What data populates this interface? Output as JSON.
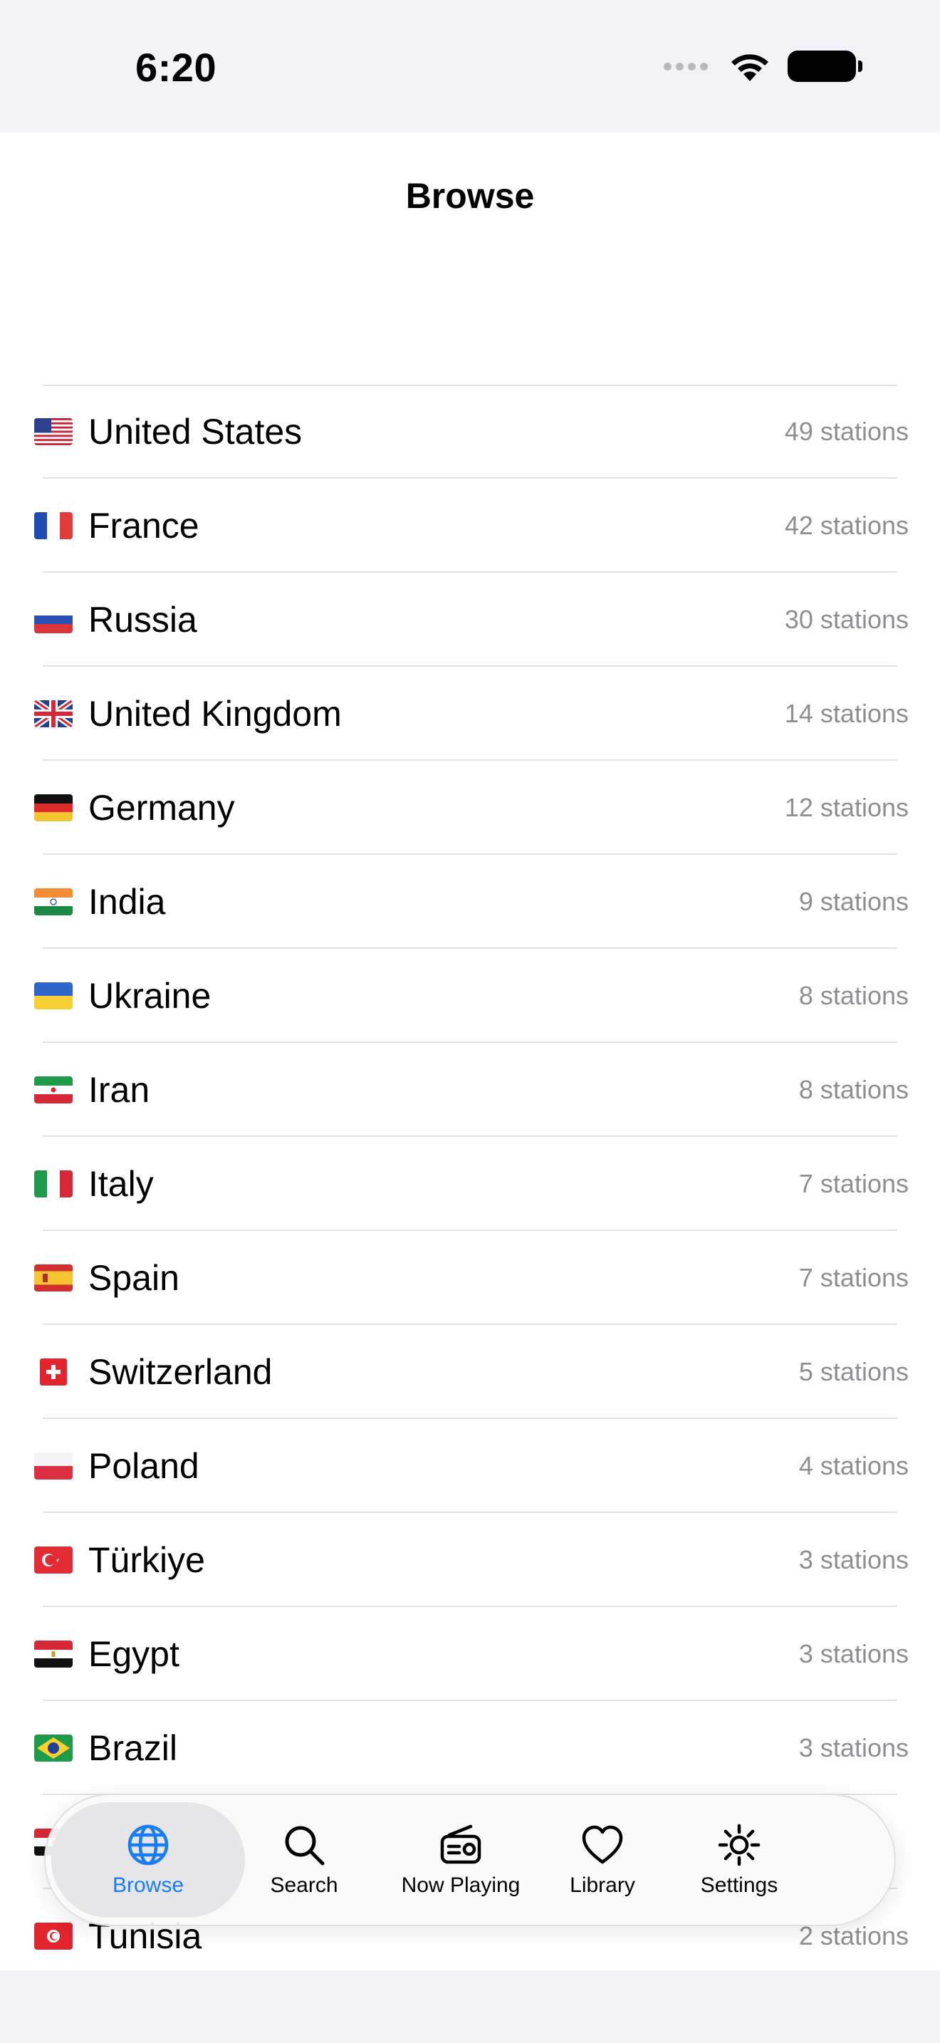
{
  "status_bar": {
    "time": "6:20"
  },
  "nav": {
    "title": "Browse"
  },
  "countries": [
    {
      "name": "United States",
      "count": "49 stations",
      "flag": "us"
    },
    {
      "name": "France",
      "count": "42 stations",
      "flag": "fr"
    },
    {
      "name": "Russia",
      "count": "30 stations",
      "flag": "ru"
    },
    {
      "name": "United Kingdom",
      "count": "14 stations",
      "flag": "gb"
    },
    {
      "name": "Germany",
      "count": "12 stations",
      "flag": "de"
    },
    {
      "name": "India",
      "count": "9 stations",
      "flag": "in"
    },
    {
      "name": "Ukraine",
      "count": "8 stations",
      "flag": "ua"
    },
    {
      "name": "Iran",
      "count": "8 stations",
      "flag": "ir"
    },
    {
      "name": "Italy",
      "count": "7 stations",
      "flag": "it"
    },
    {
      "name": "Spain",
      "count": "7 stations",
      "flag": "es"
    },
    {
      "name": "Switzerland",
      "count": "5 stations",
      "flag": "ch"
    },
    {
      "name": "Poland",
      "count": "4 stations",
      "flag": "pl"
    },
    {
      "name": "Türkiye",
      "count": "3 stations",
      "flag": "tr"
    },
    {
      "name": "Egypt",
      "count": "3 stations",
      "flag": "eg"
    },
    {
      "name": "Brazil",
      "count": "3 stations",
      "flag": "br"
    },
    {
      "name": "",
      "count": "",
      "flag": "eg"
    },
    {
      "name": "Tunisia",
      "count": "2 stations",
      "flag": "tn"
    }
  ],
  "tabs": [
    {
      "label": "Browse",
      "icon": "globe-icon",
      "active": true
    },
    {
      "label": "Search",
      "icon": "search-icon",
      "active": false
    },
    {
      "label": "Now Playing",
      "icon": "radio-icon",
      "active": false
    },
    {
      "label": "Library",
      "icon": "heart-icon",
      "active": false
    },
    {
      "label": "Settings",
      "icon": "gear-icon",
      "active": false
    }
  ],
  "colors": {
    "accent": "#1a7cf5",
    "secondary_text": "#8e8e93",
    "separator": "#e3e3e6"
  }
}
